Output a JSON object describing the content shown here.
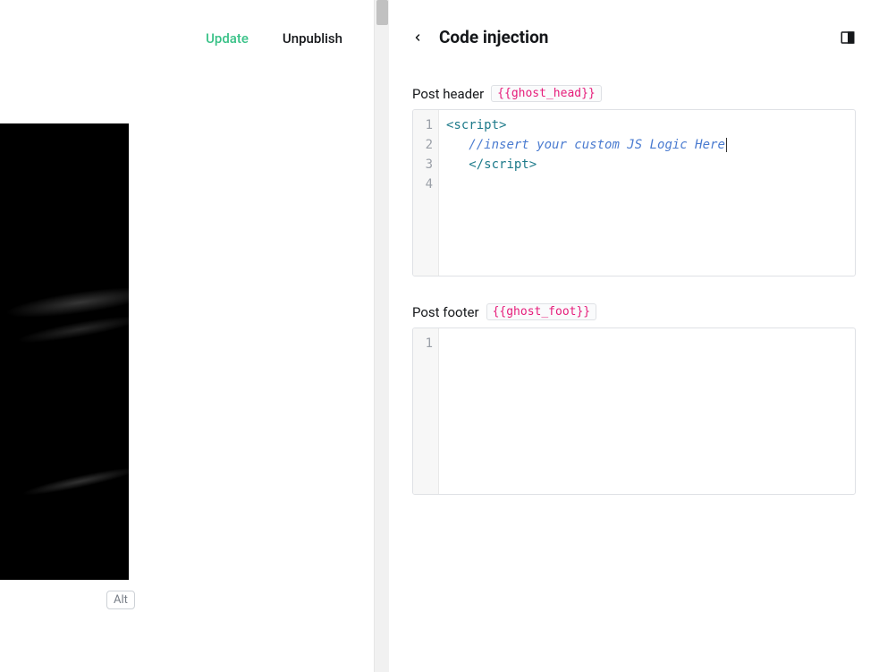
{
  "top": {
    "update_label": "Update",
    "unpublish_label": "Unpublish",
    "alt_badge": "Alt"
  },
  "panel": {
    "title": "Code injection",
    "header": {
      "label": "Post header",
      "tag": "{{ghost_head}}",
      "lines": [
        "1",
        "2",
        "3",
        "4"
      ],
      "code": {
        "l1_open": "<script>",
        "l2_indent": "   ",
        "l2_comment": "//insert your custom JS Logic Here",
        "l3_indent": "   ",
        "l3_close": "</script>"
      }
    },
    "footer": {
      "label": "Post footer",
      "tag": "{{ghost_foot}}",
      "lines": [
        "1"
      ]
    }
  }
}
